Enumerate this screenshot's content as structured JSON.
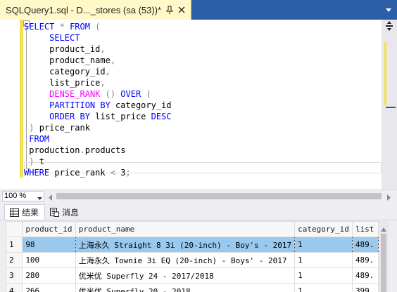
{
  "tab": {
    "title": "SQLQuery1.sql - D..._stores (sa (53))*"
  },
  "editor": {
    "fold_symbol": "−",
    "lines": [
      [
        {
          "t": "SELECT",
          "c": "kw"
        },
        {
          "t": " ",
          "c": ""
        },
        {
          "t": "*",
          "c": "op"
        },
        {
          "t": " ",
          "c": ""
        },
        {
          "t": "FROM",
          "c": "kw"
        },
        {
          "t": " ",
          "c": ""
        },
        {
          "t": "(",
          "c": "op"
        }
      ],
      [
        {
          "t": "     ",
          "c": ""
        },
        {
          "t": "SELECT",
          "c": "kw"
        }
      ],
      [
        {
          "t": "     product_id",
          "c": ""
        },
        {
          "t": ",",
          "c": "op"
        }
      ],
      [
        {
          "t": "     product_name",
          "c": ""
        },
        {
          "t": ",",
          "c": "op"
        }
      ],
      [
        {
          "t": "     category_id",
          "c": ""
        },
        {
          "t": ",",
          "c": "op"
        }
      ],
      [
        {
          "t": "     list_price",
          "c": ""
        },
        {
          "t": ",",
          "c": "op"
        }
      ],
      [
        {
          "t": "     ",
          "c": ""
        },
        {
          "t": "DENSE_RANK",
          "c": "fn"
        },
        {
          "t": " ",
          "c": ""
        },
        {
          "t": "()",
          "c": "op"
        },
        {
          "t": " ",
          "c": ""
        },
        {
          "t": "OVER",
          "c": "kw"
        },
        {
          "t": " ",
          "c": ""
        },
        {
          "t": "(",
          "c": "op"
        }
      ],
      [
        {
          "t": "     ",
          "c": ""
        },
        {
          "t": "PARTITION BY",
          "c": "kw"
        },
        {
          "t": " category_id",
          "c": ""
        }
      ],
      [
        {
          "t": "     ",
          "c": ""
        },
        {
          "t": "ORDER BY",
          "c": "kw"
        },
        {
          "t": " list_price ",
          "c": ""
        },
        {
          "t": "DESC",
          "c": "kw"
        }
      ],
      [
        {
          "t": " ",
          "c": ""
        },
        {
          "t": ")",
          "c": "op"
        },
        {
          "t": " price_rank",
          "c": ""
        }
      ],
      [
        {
          "t": " ",
          "c": ""
        },
        {
          "t": "FROM",
          "c": "kw"
        }
      ],
      [
        {
          "t": " production",
          "c": ""
        },
        {
          "t": ".",
          "c": "op"
        },
        {
          "t": "products",
          "c": ""
        }
      ],
      [
        {
          "t": " ",
          "c": ""
        },
        {
          "t": ")",
          "c": "op"
        },
        {
          "t": " t",
          "c": ""
        }
      ],
      [
        {
          "t": "WHERE",
          "c": "kw"
        },
        {
          "t": " price_rank ",
          "c": ""
        },
        {
          "t": "<",
          "c": "op"
        },
        {
          "t": " 3",
          "c": ""
        },
        {
          "t": ";",
          "c": "op"
        }
      ]
    ]
  },
  "zoom": {
    "value": "100 %"
  },
  "result_tabs": {
    "results": "结果",
    "messages": "消息"
  },
  "grid": {
    "columns": [
      "",
      "product_id",
      "product_name",
      "category_id",
      "list"
    ],
    "rows": [
      [
        "1",
        "98",
        "上海永久 Straight 8 3i (20-inch) - Boy's - 2017",
        "1",
        "489."
      ],
      [
        "2",
        "100",
        "上海永久 Townie 3i EQ (20-inch) - Boys' - 2017",
        "1",
        "489."
      ],
      [
        "3",
        "280",
        "优米优 Superfly 24 - 2017/2018",
        "1",
        "489."
      ],
      [
        "4",
        "266",
        "优米优 Superfly 20 - 2018",
        "1",
        "399."
      ]
    ]
  },
  "colors": {
    "tab_bg": "#fff8c9",
    "titlebar": "#2d5fa8",
    "selection": "#99c9ef",
    "keyword": "#0000ff",
    "function": "#ff00ff"
  }
}
